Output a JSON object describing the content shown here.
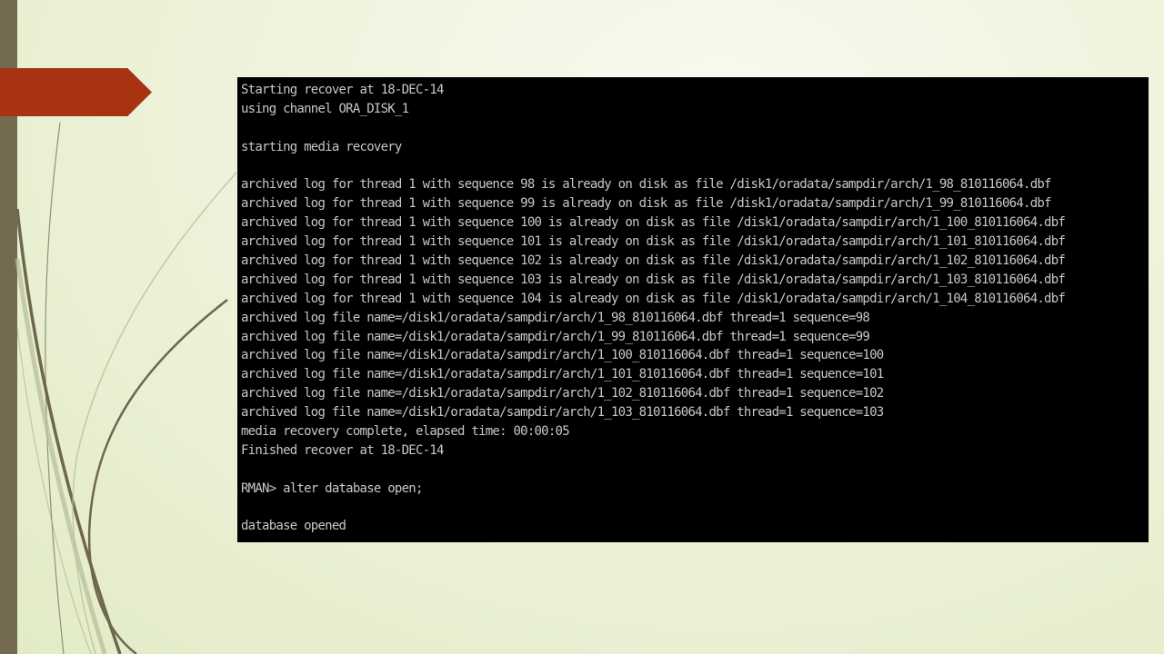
{
  "terminal": {
    "lines": [
      "Starting recover at 18-DEC-14",
      "using channel ORA_DISK_1",
      "",
      "starting media recovery",
      "",
      "archived log for thread 1 with sequence 98 is already on disk as file /disk1/oradata/sampdir/arch/1_98_810116064.dbf",
      "archived log for thread 1 with sequence 99 is already on disk as file /disk1/oradata/sampdir/arch/1_99_810116064.dbf",
      "archived log for thread 1 with sequence 100 is already on disk as file /disk1/oradata/sampdir/arch/1_100_810116064.dbf",
      "archived log for thread 1 with sequence 101 is already on disk as file /disk1/oradata/sampdir/arch/1_101_810116064.dbf",
      "archived log for thread 1 with sequence 102 is already on disk as file /disk1/oradata/sampdir/arch/1_102_810116064.dbf",
      "archived log for thread 1 with sequence 103 is already on disk as file /disk1/oradata/sampdir/arch/1_103_810116064.dbf",
      "archived log for thread 1 with sequence 104 is already on disk as file /disk1/oradata/sampdir/arch/1_104_810116064.dbf",
      "archived log file name=/disk1/oradata/sampdir/arch/1_98_810116064.dbf thread=1 sequence=98",
      "archived log file name=/disk1/oradata/sampdir/arch/1_99_810116064.dbf thread=1 sequence=99",
      "archived log file name=/disk1/oradata/sampdir/arch/1_100_810116064.dbf thread=1 sequence=100",
      "archived log file name=/disk1/oradata/sampdir/arch/1_101_810116064.dbf thread=1 sequence=101",
      "archived log file name=/disk1/oradata/sampdir/arch/1_102_810116064.dbf thread=1 sequence=102",
      "archived log file name=/disk1/oradata/sampdir/arch/1_103_810116064.dbf thread=1 sequence=103",
      "media recovery complete, elapsed time: 00:00:05",
      "Finished recover at 18-DEC-14",
      "",
      "RMAN> alter database open;",
      "",
      "database opened"
    ]
  },
  "theme": {
    "background": "#eef3dc",
    "strip_color": "#736a50",
    "banner_color": "#a83312",
    "terminal_bg": "#000000",
    "terminal_fg": "#c8c8c8"
  }
}
